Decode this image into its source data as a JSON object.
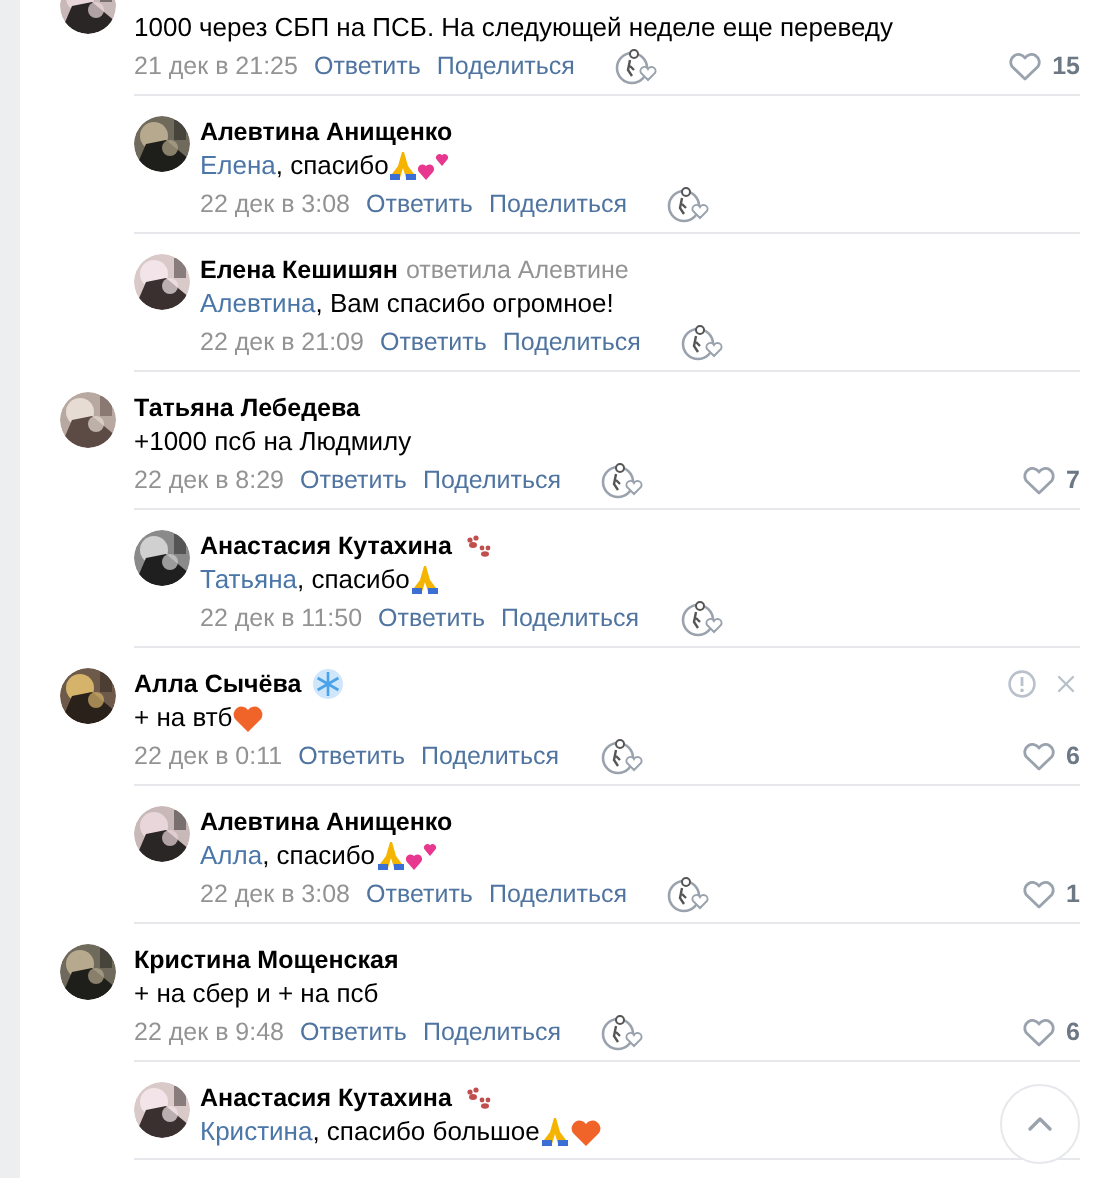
{
  "comments": [
    {
      "text": "1000 через СБП на ПСБ. На следующей неделе еще переведу",
      "date": "21 дек в 21:25",
      "reply_label": "Ответить",
      "share_label": "Поделиться",
      "likes": "15",
      "replies": [
        {
          "author": "Алевтина Анищенко",
          "mention": "Елена",
          "text": ", спасибо",
          "emojis": [
            {
              "kind": "pray"
            },
            {
              "kind": "two-hearts"
            }
          ],
          "date": "22 дек в 3:08",
          "reply_label": "Ответить",
          "share_label": "Поделиться"
        },
        {
          "author": "Елена Кешишян",
          "replied_note": "ответила Алевтине",
          "mention": "Алевтина",
          "text": ", Вам спасибо огромное!",
          "date": "22 дек в 21:09",
          "reply_label": "Ответить",
          "share_label": "Поделиться"
        }
      ]
    },
    {
      "author": "Татьяна Лебедева",
      "text": "+1000 псб на Людмилу",
      "date": "22 дек в 8:29",
      "reply_label": "Ответить",
      "share_label": "Поделиться",
      "likes": "7",
      "replies": [
        {
          "author": "Анастасия Кутахина",
          "name_badge": {
            "kind": "paws"
          },
          "mention": "Татьяна",
          "text": ", спасибо",
          "emojis": [
            {
              "kind": "pray"
            }
          ],
          "date": "22 дек в 11:50",
          "reply_label": "Ответить",
          "share_label": "Поделиться"
        }
      ]
    },
    {
      "author": "Алла Сычёва",
      "name_badge": {
        "kind": "snowflake"
      },
      "show_actions": true,
      "text": "+ на втб",
      "emojis": [
        {
          "kind": "heart"
        }
      ],
      "date": "22 дек в 0:11",
      "reply_label": "Ответить",
      "share_label": "Поделиться",
      "likes": "6",
      "replies": [
        {
          "author": "Алевтина Анищенко",
          "mention": "Алла",
          "text": ", спасибо",
          "emojis": [
            {
              "kind": "pray"
            },
            {
              "kind": "two-hearts"
            }
          ],
          "date": "22 дек в 3:08",
          "reply_label": "Ответить",
          "share_label": "Поделиться",
          "likes": "1"
        }
      ]
    },
    {
      "author": "Кристина Мощенская",
      "text": "+ на сбер и + на псб",
      "date": "22 дек в 9:48",
      "reply_label": "Ответить",
      "share_label": "Поделиться",
      "likes": "6",
      "replies": [
        {
          "author": "Анастасия Кутахина",
          "name_badge": {
            "kind": "paws"
          },
          "mention": "Кристина",
          "text": ", спасибо большое",
          "emojis": [
            {
              "kind": "pray"
            },
            {
              "kind": "heart"
            }
          ]
        }
      ]
    }
  ],
  "scroll_top_button": true
}
